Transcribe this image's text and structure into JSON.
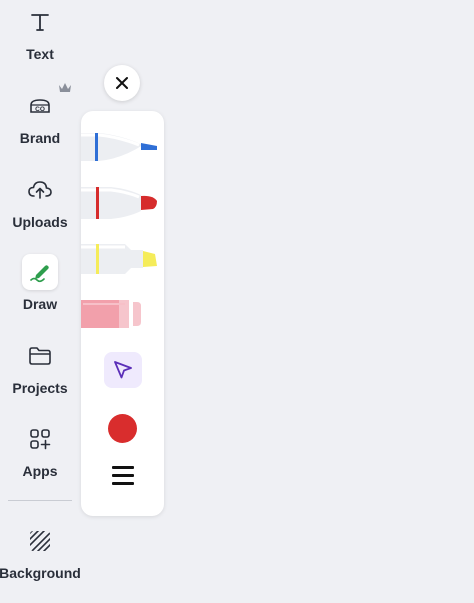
{
  "sidebar": {
    "items": [
      {
        "label": "Text",
        "icon": "text-icon"
      },
      {
        "label": "Brand",
        "icon": "brand-icon",
        "badge": "crown-icon"
      },
      {
        "label": "Uploads",
        "icon": "upload-cloud-icon"
      },
      {
        "label": "Draw",
        "icon": "draw-icon",
        "active": true
      },
      {
        "label": "Projects",
        "icon": "folder-icon"
      },
      {
        "label": "Apps",
        "icon": "apps-icon"
      },
      {
        "label": "Background",
        "icon": "background-icon"
      }
    ],
    "brand_icon_text": "CO"
  },
  "draw_panel": {
    "tools": [
      {
        "name": "pen",
        "color": "#2f6fd6"
      },
      {
        "name": "marker",
        "color": "#d62c2c"
      },
      {
        "name": "highlighter",
        "color": "#f5ec5a"
      },
      {
        "name": "eraser",
        "color": "#f2a0ab"
      },
      {
        "name": "select",
        "icon": "cursor-arrow-icon",
        "color": "#5b2fb8"
      }
    ],
    "current_color": "#d92d2d",
    "menu_icon": "menu-icon",
    "close_icon": "close-icon"
  }
}
